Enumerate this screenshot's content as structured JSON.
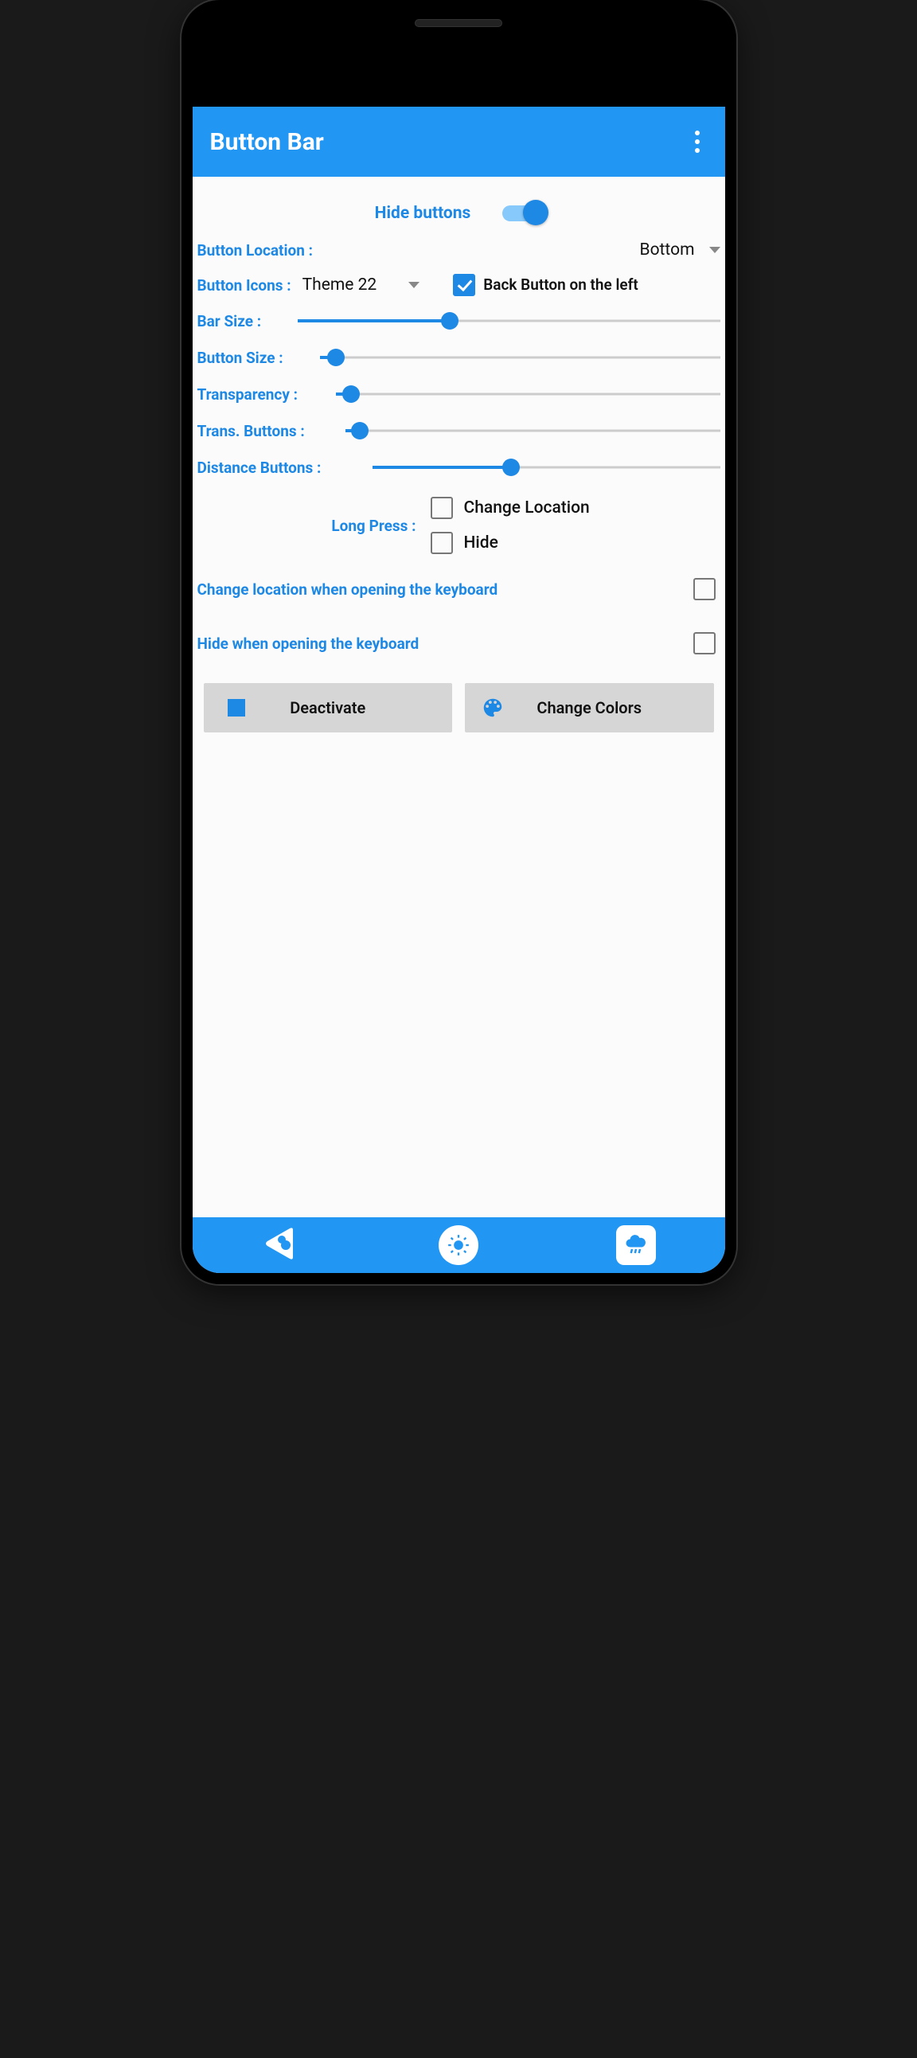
{
  "header": {
    "title": "Button Bar"
  },
  "settings": {
    "hide_label": "Hide buttons",
    "hide_on": true,
    "location": {
      "label": "Button Location :",
      "value": "Bottom"
    },
    "icons": {
      "label": "Button Icons :",
      "value": "Theme 22"
    },
    "back_left": {
      "label": "Back Button on the left",
      "checked": true
    },
    "bar_size": {
      "label": "Bar Size :",
      "value": 36
    },
    "button_size": {
      "label": "Button Size :",
      "value": 4
    },
    "transparency": {
      "label": "Transparency :",
      "value": 4
    },
    "trans_buttons": {
      "label": "Trans. Buttons :",
      "value": 4
    },
    "distance": {
      "label": "Distance Buttons :",
      "value": 40
    },
    "long_press": {
      "label": "Long Press :",
      "change_location": {
        "label": "Change Location",
        "checked": false
      },
      "hide": {
        "label": "Hide",
        "checked": false
      }
    },
    "change_loc_kb": {
      "label": "Change location when opening the keyboard",
      "checked": false
    },
    "hide_kb": {
      "label": "Hide when opening the keyboard",
      "checked": false
    },
    "deactivate_label": "Deactivate",
    "colors_label": "Change Colors"
  }
}
